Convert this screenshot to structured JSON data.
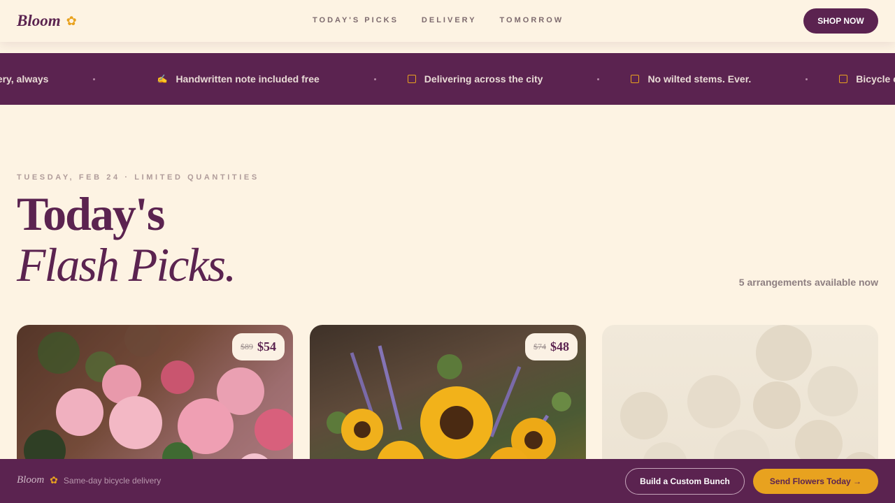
{
  "header": {
    "logo": "Bloom",
    "logo_icon": "flower-icon",
    "nav": [
      "TODAY'S PICKS",
      "DELIVERY",
      "TOMORROW"
    ],
    "cta": "SHOP NOW"
  },
  "marquee": {
    "items": [
      {
        "text": "very, always",
        "icon": ""
      },
      {
        "text": "Handwritten note included free",
        "icon": "pen-icon"
      },
      {
        "text": "Delivering across the city",
        "icon": "box-icon"
      },
      {
        "text": "No wilted stems. Ever.",
        "icon": "box-icon"
      },
      {
        "text": "Bicycle couriers wh",
        "icon": "box-icon"
      }
    ]
  },
  "hero": {
    "eyebrow": "TUESDAY, FEB 24 · LIMITED QUANTITIES",
    "title_line1": "Today's",
    "title_line2": "Flash Picks.",
    "available": "5 arrangements available now"
  },
  "cards": [
    {
      "old_price": "$89",
      "new_price": "$54"
    },
    {
      "old_price": "$74",
      "new_price": "$48"
    },
    {}
  ],
  "footer": {
    "logo": "Bloom",
    "tagline": "Same-day bicycle delivery",
    "custom_button": "Build a Custom Bunch",
    "send_button": "Send Flowers Today →"
  },
  "colors": {
    "plum": "#5b2350",
    "cream": "#fdf3e3",
    "gold": "#e8a21f"
  }
}
